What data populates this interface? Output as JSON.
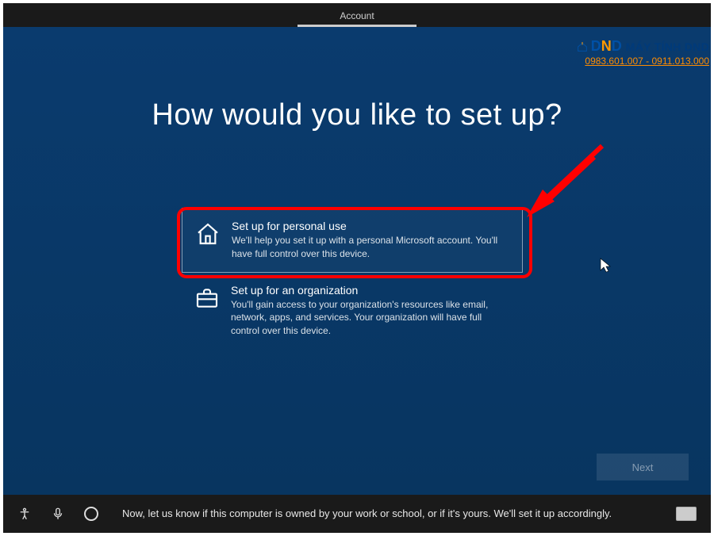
{
  "topbar": {
    "tab_label": "Account"
  },
  "title": "How would you like to set up?",
  "options": [
    {
      "icon": "home-icon",
      "title": "Set up for personal use",
      "desc": "We'll help you set it up with a personal Microsoft account. You'll have full control over this device.",
      "selected": true
    },
    {
      "icon": "briefcase-icon",
      "title": "Set up for an organization",
      "desc": "You'll gain access to your organization's resources like email, network, apps, and services. Your organization will have full control over this device.",
      "selected": false
    }
  ],
  "next_button": "Next",
  "narration": "Now, let us know if this computer is owned by your work or school, or if it's yours. We'll set it up accordingly.",
  "watermark": {
    "brand": "MÁY TÍNH DND",
    "phone": "0983.601.007 - 0911.013.000"
  },
  "colors": {
    "bg": "#0a3b6e",
    "highlight": "#ff0000",
    "accent_phone": "#ff8c00"
  }
}
